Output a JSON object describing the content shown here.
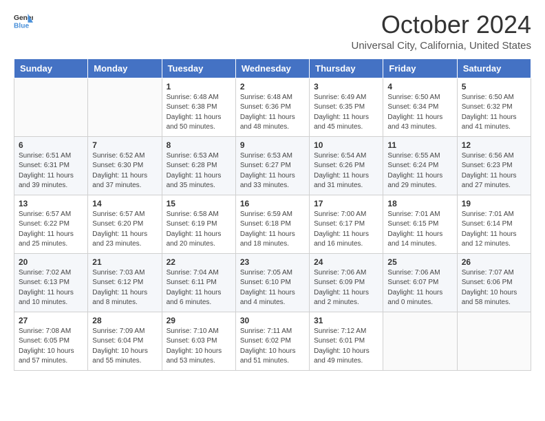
{
  "logo": {
    "text_general": "General",
    "text_blue": "Blue",
    "flag_shape": "triangle"
  },
  "header": {
    "month_title": "October 2024",
    "location": "Universal City, California, United States"
  },
  "weekdays": [
    "Sunday",
    "Monday",
    "Tuesday",
    "Wednesday",
    "Thursday",
    "Friday",
    "Saturday"
  ],
  "weeks": [
    [
      {
        "day": "",
        "sunrise": "",
        "sunset": "",
        "daylight": ""
      },
      {
        "day": "",
        "sunrise": "",
        "sunset": "",
        "daylight": ""
      },
      {
        "day": "1",
        "sunrise": "Sunrise: 6:48 AM",
        "sunset": "Sunset: 6:38 PM",
        "daylight": "Daylight: 11 hours and 50 minutes."
      },
      {
        "day": "2",
        "sunrise": "Sunrise: 6:48 AM",
        "sunset": "Sunset: 6:36 PM",
        "daylight": "Daylight: 11 hours and 48 minutes."
      },
      {
        "day": "3",
        "sunrise": "Sunrise: 6:49 AM",
        "sunset": "Sunset: 6:35 PM",
        "daylight": "Daylight: 11 hours and 45 minutes."
      },
      {
        "day": "4",
        "sunrise": "Sunrise: 6:50 AM",
        "sunset": "Sunset: 6:34 PM",
        "daylight": "Daylight: 11 hours and 43 minutes."
      },
      {
        "day": "5",
        "sunrise": "Sunrise: 6:50 AM",
        "sunset": "Sunset: 6:32 PM",
        "daylight": "Daylight: 11 hours and 41 minutes."
      }
    ],
    [
      {
        "day": "6",
        "sunrise": "Sunrise: 6:51 AM",
        "sunset": "Sunset: 6:31 PM",
        "daylight": "Daylight: 11 hours and 39 minutes."
      },
      {
        "day": "7",
        "sunrise": "Sunrise: 6:52 AM",
        "sunset": "Sunset: 6:30 PM",
        "daylight": "Daylight: 11 hours and 37 minutes."
      },
      {
        "day": "8",
        "sunrise": "Sunrise: 6:53 AM",
        "sunset": "Sunset: 6:28 PM",
        "daylight": "Daylight: 11 hours and 35 minutes."
      },
      {
        "day": "9",
        "sunrise": "Sunrise: 6:53 AM",
        "sunset": "Sunset: 6:27 PM",
        "daylight": "Daylight: 11 hours and 33 minutes."
      },
      {
        "day": "10",
        "sunrise": "Sunrise: 6:54 AM",
        "sunset": "Sunset: 6:26 PM",
        "daylight": "Daylight: 11 hours and 31 minutes."
      },
      {
        "day": "11",
        "sunrise": "Sunrise: 6:55 AM",
        "sunset": "Sunset: 6:24 PM",
        "daylight": "Daylight: 11 hours and 29 minutes."
      },
      {
        "day": "12",
        "sunrise": "Sunrise: 6:56 AM",
        "sunset": "Sunset: 6:23 PM",
        "daylight": "Daylight: 11 hours and 27 minutes."
      }
    ],
    [
      {
        "day": "13",
        "sunrise": "Sunrise: 6:57 AM",
        "sunset": "Sunset: 6:22 PM",
        "daylight": "Daylight: 11 hours and 25 minutes."
      },
      {
        "day": "14",
        "sunrise": "Sunrise: 6:57 AM",
        "sunset": "Sunset: 6:20 PM",
        "daylight": "Daylight: 11 hours and 23 minutes."
      },
      {
        "day": "15",
        "sunrise": "Sunrise: 6:58 AM",
        "sunset": "Sunset: 6:19 PM",
        "daylight": "Daylight: 11 hours and 20 minutes."
      },
      {
        "day": "16",
        "sunrise": "Sunrise: 6:59 AM",
        "sunset": "Sunset: 6:18 PM",
        "daylight": "Daylight: 11 hours and 18 minutes."
      },
      {
        "day": "17",
        "sunrise": "Sunrise: 7:00 AM",
        "sunset": "Sunset: 6:17 PM",
        "daylight": "Daylight: 11 hours and 16 minutes."
      },
      {
        "day": "18",
        "sunrise": "Sunrise: 7:01 AM",
        "sunset": "Sunset: 6:15 PM",
        "daylight": "Daylight: 11 hours and 14 minutes."
      },
      {
        "day": "19",
        "sunrise": "Sunrise: 7:01 AM",
        "sunset": "Sunset: 6:14 PM",
        "daylight": "Daylight: 11 hours and 12 minutes."
      }
    ],
    [
      {
        "day": "20",
        "sunrise": "Sunrise: 7:02 AM",
        "sunset": "Sunset: 6:13 PM",
        "daylight": "Daylight: 11 hours and 10 minutes."
      },
      {
        "day": "21",
        "sunrise": "Sunrise: 7:03 AM",
        "sunset": "Sunset: 6:12 PM",
        "daylight": "Daylight: 11 hours and 8 minutes."
      },
      {
        "day": "22",
        "sunrise": "Sunrise: 7:04 AM",
        "sunset": "Sunset: 6:11 PM",
        "daylight": "Daylight: 11 hours and 6 minutes."
      },
      {
        "day": "23",
        "sunrise": "Sunrise: 7:05 AM",
        "sunset": "Sunset: 6:10 PM",
        "daylight": "Daylight: 11 hours and 4 minutes."
      },
      {
        "day": "24",
        "sunrise": "Sunrise: 7:06 AM",
        "sunset": "Sunset: 6:09 PM",
        "daylight": "Daylight: 11 hours and 2 minutes."
      },
      {
        "day": "25",
        "sunrise": "Sunrise: 7:06 AM",
        "sunset": "Sunset: 6:07 PM",
        "daylight": "Daylight: 11 hours and 0 minutes."
      },
      {
        "day": "26",
        "sunrise": "Sunrise: 7:07 AM",
        "sunset": "Sunset: 6:06 PM",
        "daylight": "Daylight: 10 hours and 58 minutes."
      }
    ],
    [
      {
        "day": "27",
        "sunrise": "Sunrise: 7:08 AM",
        "sunset": "Sunset: 6:05 PM",
        "daylight": "Daylight: 10 hours and 57 minutes."
      },
      {
        "day": "28",
        "sunrise": "Sunrise: 7:09 AM",
        "sunset": "Sunset: 6:04 PM",
        "daylight": "Daylight: 10 hours and 55 minutes."
      },
      {
        "day": "29",
        "sunrise": "Sunrise: 7:10 AM",
        "sunset": "Sunset: 6:03 PM",
        "daylight": "Daylight: 10 hours and 53 minutes."
      },
      {
        "day": "30",
        "sunrise": "Sunrise: 7:11 AM",
        "sunset": "Sunset: 6:02 PM",
        "daylight": "Daylight: 10 hours and 51 minutes."
      },
      {
        "day": "31",
        "sunrise": "Sunrise: 7:12 AM",
        "sunset": "Sunset: 6:01 PM",
        "daylight": "Daylight: 10 hours and 49 minutes."
      },
      {
        "day": "",
        "sunrise": "",
        "sunset": "",
        "daylight": ""
      },
      {
        "day": "",
        "sunrise": "",
        "sunset": "",
        "daylight": ""
      }
    ]
  ]
}
